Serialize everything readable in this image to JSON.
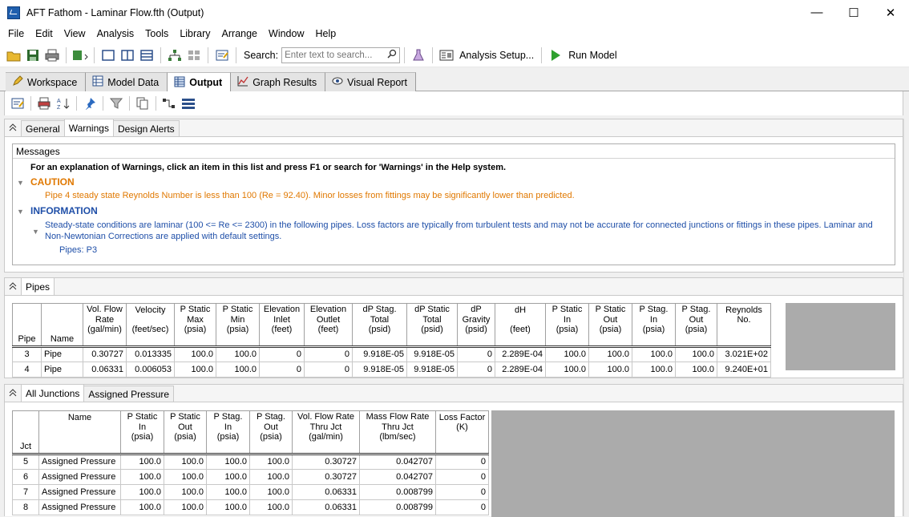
{
  "window": {
    "title": "AFT Fathom - Laminar Flow.fth (Output)",
    "minimize": "—",
    "maximize": "☐",
    "close": "✕"
  },
  "menu": [
    "File",
    "Edit",
    "View",
    "Analysis",
    "Tools",
    "Library",
    "Arrange",
    "Window",
    "Help"
  ],
  "toolbar": {
    "search_label": "Search:",
    "search_placeholder": "Enter text to search...",
    "analysis_setup": "Analysis Setup...",
    "run_model": "Run Model"
  },
  "main_tabs": [
    {
      "label": "Workspace",
      "icon": "pencil-icon"
    },
    {
      "label": "Model Data",
      "icon": "model-data-icon"
    },
    {
      "label": "Output",
      "icon": "table-icon"
    },
    {
      "label": "Graph Results",
      "icon": "graph-icon"
    },
    {
      "label": "Visual Report",
      "icon": "eye-icon"
    }
  ],
  "general_tabs": [
    "General",
    "Warnings",
    "Design Alerts"
  ],
  "messages": {
    "header": "Messages",
    "intro": "For an explanation of Warnings, click an item in this list and press F1 or search for 'Warnings' in the Help system.",
    "caution_title": "CAUTION",
    "caution_text": "Pipe 4 steady state Reynolds Number is less than 100 (Re = 92.40). Minor losses from fittings may be significantly lower than predicted.",
    "information_title": "INFORMATION",
    "info_text_1": "Steady-state conditions are laminar (100 <= Re <= 2300) in the following pipes. Loss factors are typically from turbulent tests and may not be accurate for connected junctions or fittings in these pipes. Laminar and",
    "info_text_2": "Non-Newtonian Corrections are applied with default settings.",
    "pipes_list": "Pipes: P3",
    "colors": {
      "caution": "#e07800",
      "info": "#1f4fa8"
    }
  },
  "pipes_tab": "Pipes",
  "pipes_table": {
    "headers": [
      [
        "",
        "",
        "",
        "Pipe"
      ],
      [
        "",
        "",
        "",
        "Name"
      ],
      [
        "Vol. Flow",
        "Rate",
        "(gal/min)",
        ""
      ],
      [
        "Velocity",
        "",
        "(feet/sec)",
        ""
      ],
      [
        "P Static",
        "Max",
        "(psia)",
        ""
      ],
      [
        "P Static",
        "Min",
        "(psia)",
        ""
      ],
      [
        "Elevation",
        "Inlet",
        "(feet)",
        ""
      ],
      [
        "Elevation",
        "Outlet",
        "(feet)",
        ""
      ],
      [
        "dP Stag.",
        "Total",
        "(psid)",
        ""
      ],
      [
        "dP Static",
        "Total",
        "(psid)",
        ""
      ],
      [
        "dP",
        "Gravity",
        "(psid)",
        ""
      ],
      [
        "dH",
        "",
        "(feet)",
        ""
      ],
      [
        "P Static",
        "In",
        "(psia)",
        ""
      ],
      [
        "P Static",
        "Out",
        "(psia)",
        ""
      ],
      [
        "P Stag.",
        "In",
        "(psia)",
        ""
      ],
      [
        "P Stag.",
        "Out",
        "(psia)",
        ""
      ],
      [
        "Reynolds",
        "No.",
        "",
        ""
      ]
    ],
    "rows": [
      [
        "3",
        "Pipe",
        "0.30727",
        "0.013335",
        "100.0",
        "100.0",
        "0",
        "0",
        "9.918E-05",
        "9.918E-05",
        "0",
        "2.289E-04",
        "100.0",
        "100.0",
        "100.0",
        "100.0",
        "3.021E+02"
      ],
      [
        "4",
        "Pipe",
        "0.06331",
        "0.006053",
        "100.0",
        "100.0",
        "0",
        "0",
        "9.918E-05",
        "9.918E-05",
        "0",
        "2.289E-04",
        "100.0",
        "100.0",
        "100.0",
        "100.0",
        "9.240E+01"
      ]
    ]
  },
  "junction_tabs": [
    "All Junctions",
    "Assigned Pressure"
  ],
  "junctions_table": {
    "headers": [
      [
        "",
        "",
        "",
        "Jct"
      ],
      [
        "Name",
        "",
        "",
        ""
      ],
      [
        "P Static",
        "In",
        "(psia)",
        ""
      ],
      [
        "P Static",
        "Out",
        "(psia)",
        ""
      ],
      [
        "P Stag.",
        "In",
        "(psia)",
        ""
      ],
      [
        "P Stag.",
        "Out",
        "(psia)",
        ""
      ],
      [
        "Vol. Flow Rate",
        "Thru Jct",
        "(gal/min)",
        ""
      ],
      [
        "Mass Flow Rate",
        "Thru Jct",
        "(lbm/sec)",
        ""
      ],
      [
        "Loss Factor",
        "(K)",
        "",
        ""
      ]
    ],
    "rows": [
      [
        "5",
        "Assigned Pressure",
        "100.0",
        "100.0",
        "100.0",
        "100.0",
        "0.30727",
        "0.042707",
        "0"
      ],
      [
        "6",
        "Assigned Pressure",
        "100.0",
        "100.0",
        "100.0",
        "100.0",
        "0.30727",
        "0.042707",
        "0"
      ],
      [
        "7",
        "Assigned Pressure",
        "100.0",
        "100.0",
        "100.0",
        "100.0",
        "0.06331",
        "0.008799",
        "0"
      ],
      [
        "8",
        "Assigned Pressure",
        "100.0",
        "100.0",
        "100.0",
        "100.0",
        "0.06331",
        "0.008799",
        "0"
      ]
    ]
  }
}
